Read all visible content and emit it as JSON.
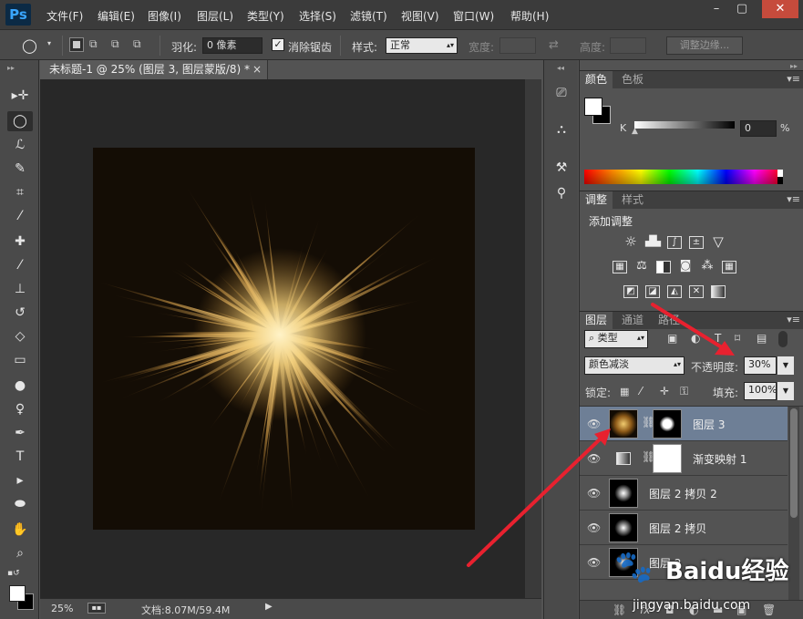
{
  "app": {
    "logo": "Ps"
  },
  "menus": [
    "文件(F)",
    "编辑(E)",
    "图像(I)",
    "图层(L)",
    "类型(Y)",
    "选择(S)",
    "滤镜(T)",
    "视图(V)",
    "窗口(W)",
    "帮助(H)"
  ],
  "window_controls": {
    "minimize": "–",
    "restore": "▢",
    "close": "✕"
  },
  "options": {
    "feather_label": "羽化:",
    "feather_value": "0 像素",
    "antialias_label": "消除锯齿",
    "style_label": "样式:",
    "style_value": "正常",
    "width_label": "宽度:",
    "height_label": "高度:",
    "refine_edge": "调整边缘..."
  },
  "document": {
    "tab_title": "未标题-1 @ 25% (图层 3, 图层蒙版/8) *",
    "tab_close": "×",
    "zoom": "25%",
    "doc_size": "文档:8.07M/59.4M"
  },
  "panels": {
    "color": {
      "tabs": [
        "颜色",
        "色板"
      ],
      "k_label": "K",
      "k_value": "0",
      "unit": "%"
    },
    "adjustments": {
      "tabs": [
        "调整",
        "样式"
      ],
      "title": "添加调整"
    },
    "layers": {
      "tabs": [
        "图层",
        "通道",
        "路径"
      ],
      "filter_kind": "类型",
      "blend_mode": "颜色减淡",
      "opacity_label": "不透明度:",
      "opacity_value": "30%",
      "lock_label": "锁定:",
      "fill_label": "填充:",
      "fill_value": "100%",
      "items": [
        {
          "name": "图层 3",
          "selected": true
        },
        {
          "name": "渐变映射 1",
          "selected": false
        },
        {
          "name": "图层 2 拷贝 2",
          "selected": false
        },
        {
          "name": "图层 2 拷贝",
          "selected": false
        },
        {
          "name": "图层 2",
          "selected": false
        }
      ]
    }
  },
  "watermark": {
    "text": "Baidu经验",
    "url": "jingyan.baidu.com"
  },
  "colors": {
    "accent": "#e8212f",
    "selection": "#6e7f96",
    "burst": "#e8b85a"
  }
}
